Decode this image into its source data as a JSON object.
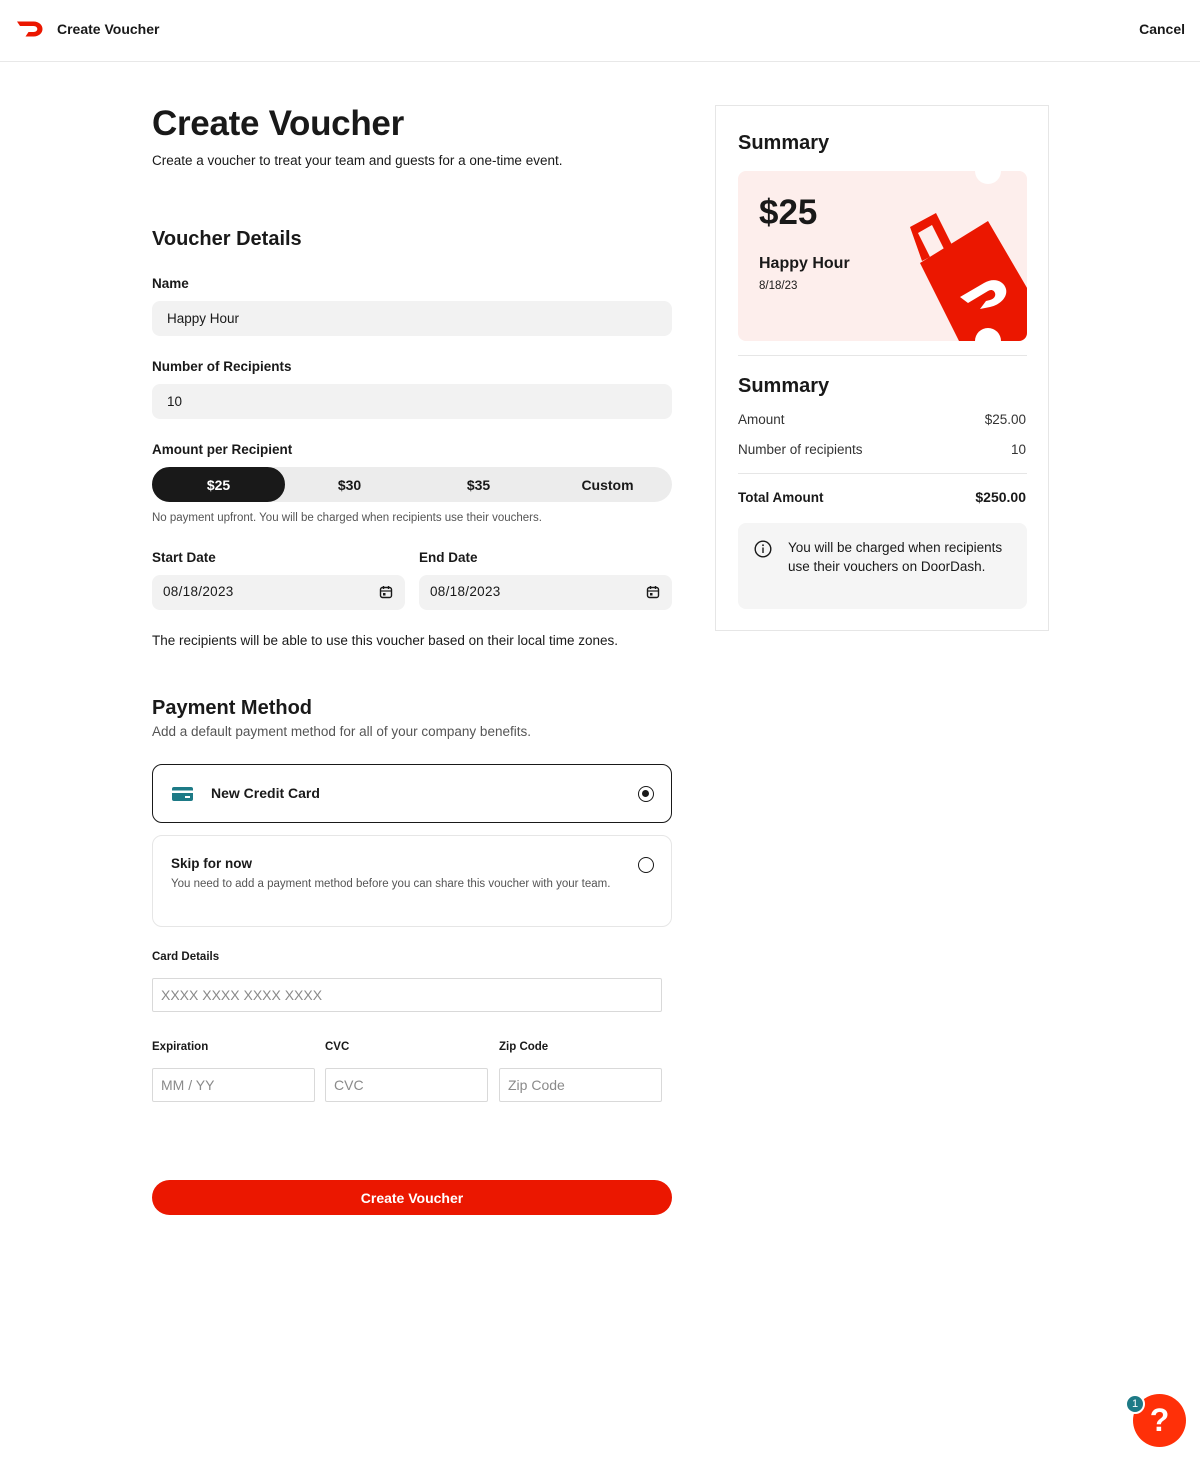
{
  "header": {
    "title": "Create Voucher",
    "cancel_label": "Cancel"
  },
  "page": {
    "title": "Create Voucher",
    "subtitle": "Create a voucher to treat your team and guests for a one-time event."
  },
  "voucher_details": {
    "heading": "Voucher Details",
    "name_label": "Name",
    "name_value": "Happy Hour",
    "recipients_label": "Number of Recipients",
    "recipients_value": "10",
    "amount_label": "Amount per Recipient",
    "amount_options": [
      "$25",
      "$30",
      "$35",
      "Custom"
    ],
    "amount_selected": "$25",
    "amount_note": "No payment upfront. You will be charged when recipients use their vouchers.",
    "start_label": "Start Date",
    "start_value": "08/18/2023",
    "end_label": "End Date",
    "end_value": "08/18/2023",
    "timezone_note": "The recipients will be able to use this voucher based on their local time zones."
  },
  "payment": {
    "heading": "Payment Method",
    "subtitle": "Add a default payment method for all of your company benefits.",
    "option_card_label": "New Credit Card",
    "option_skip_title": "Skip for now",
    "option_skip_desc": "You need to add a payment method before you can share this voucher with your team.",
    "selected": "New Credit Card",
    "card_details_label": "Card Details",
    "card_placeholder": "XXXX XXXX XXXX XXXX",
    "expiration_label": "Expiration",
    "expiration_placeholder": "MM / YY",
    "cvc_label": "CVC",
    "cvc_placeholder": "CVC",
    "zip_label": "Zip Code",
    "zip_placeholder": "Zip Code",
    "submit_label": "Create Voucher"
  },
  "summary": {
    "heading": "Summary",
    "voucher_amount": "$25",
    "voucher_name": "Happy Hour",
    "voucher_date": "8/18/23",
    "breakdown_heading": "Summary",
    "amount_label": "Amount",
    "amount_value": "$25.00",
    "recipients_label": "Number of recipients",
    "recipients_value": "10",
    "total_label": "Total Amount",
    "total_value": "$250.00",
    "info_text": "You will be charged when recipients use their vouchers on DoorDash."
  },
  "help": {
    "label": "?",
    "badge_count": "1"
  },
  "colors": {
    "brand_red": "#eb1700",
    "voucher_bg": "#fdeeec",
    "card_icon": "#1d7a86",
    "badge": "#1d7a86"
  }
}
